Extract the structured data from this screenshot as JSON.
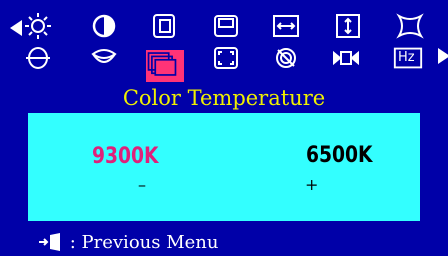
{
  "osd": {
    "icons_row1": [
      {
        "name": "left-arrow-icon"
      },
      {
        "name": "brightness-icon"
      },
      {
        "name": "contrast-icon"
      },
      {
        "name": "h-position-icon"
      },
      {
        "name": "v-position-icon"
      },
      {
        "name": "h-size-icon"
      },
      {
        "name": "v-size-icon"
      },
      {
        "name": "pincushion-icon"
      },
      {
        "name": "right-arrow-icon"
      }
    ],
    "icons_row2": [
      {
        "name": "pin-balance-icon"
      },
      {
        "name": "trapezoid-icon"
      },
      {
        "name": "color-temperature-icon",
        "selected": true
      },
      {
        "name": "zoom-icon"
      },
      {
        "name": "degauss-icon"
      },
      {
        "name": "recall-icon"
      },
      {
        "name": "display-mode-icon",
        "label": "Hz"
      }
    ],
    "selected_menu": "Color Temperature",
    "options": [
      {
        "label": "9300K",
        "symbol": "–",
        "highlighted": true
      },
      {
        "label": "6500K",
        "symbol": "+",
        "highlighted": false
      }
    ],
    "footer_text": ": Previous Menu",
    "colors": {
      "background": "#0000a8",
      "panel": "#33ffff",
      "title": "#f0f000",
      "highlight": "#e0207a",
      "selected_icon_bg": "#ff3377"
    }
  }
}
